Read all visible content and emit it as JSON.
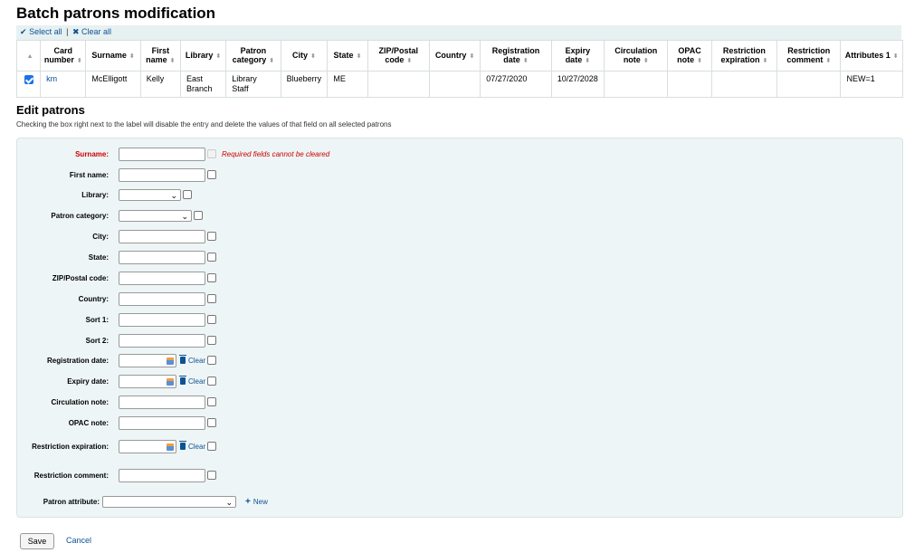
{
  "page": {
    "title": "Batch patrons modification",
    "select_all": "Select all",
    "separator": "|",
    "clear_all": "Clear all"
  },
  "table": {
    "columns": [
      "Card number",
      "Surname",
      "First name",
      "Library",
      "Patron category",
      "City",
      "State",
      "ZIP/Postal code",
      "Country",
      "Registration date",
      "Expiry date",
      "Circulation note",
      "OPAC note",
      "Restriction expiration",
      "Restriction comment",
      "Attributes 1"
    ],
    "row": {
      "card_number": "km",
      "surname": "McElligott",
      "first_name": "Kelly",
      "library": "East Branch",
      "patron_category": "Library Staff",
      "city": "Blueberry",
      "state": "ME",
      "zip": "",
      "country": "",
      "registration_date": "07/27/2020",
      "expiry_date": "10/27/2028",
      "circulation_note": "",
      "opac_note": "",
      "restriction_expiration": "",
      "restriction_comment": "",
      "attributes": "NEW=1"
    }
  },
  "edit": {
    "heading": "Edit patrons",
    "hint": "Checking the box right next to the label will disable the entry and delete the values of that field on all selected patrons",
    "required_note": "Required fields cannot be cleared",
    "fields": {
      "surname": "Surname:",
      "first_name": "First name:",
      "library": "Library:",
      "patron_category": "Patron category:",
      "city": "City:",
      "state": "State:",
      "zip": "ZIP/Postal code:",
      "country": "Country:",
      "sort1": "Sort 1:",
      "sort2": "Sort 2:",
      "registration_date": "Registration date:",
      "expiry_date": "Expiry date:",
      "circulation_note": "Circulation note:",
      "opac_note": "OPAC note:",
      "restriction_expiration": "Restriction expiration:",
      "restriction_comment": "Restriction comment:",
      "patron_attribute": "Patron attribute:"
    },
    "clear_label": "Clear",
    "new_label": "New"
  },
  "actions": {
    "save": "Save",
    "cancel": "Cancel"
  },
  "colors": {
    "accent": "#0b5394",
    "required": "#cc0000",
    "panel": "#eef5f6"
  }
}
